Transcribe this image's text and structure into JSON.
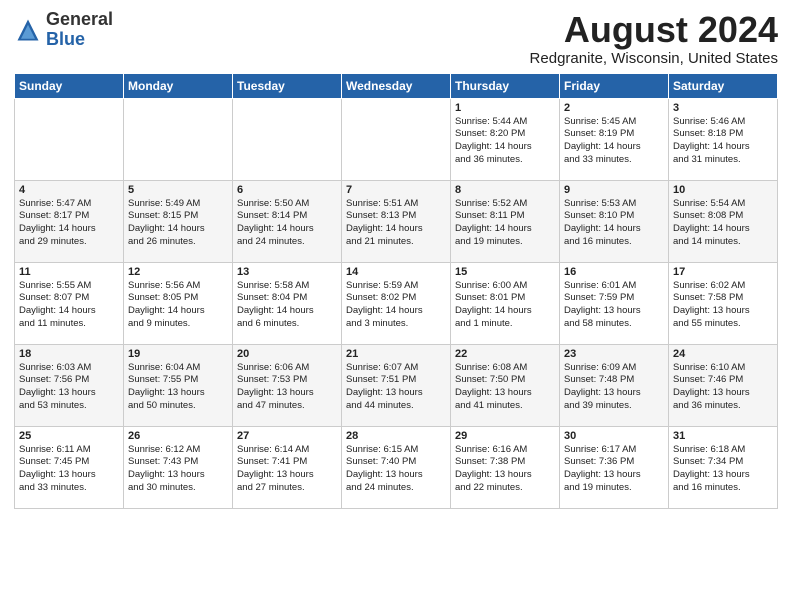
{
  "logo": {
    "general": "General",
    "blue": "Blue"
  },
  "title": "August 2024",
  "location": "Redgranite, Wisconsin, United States",
  "weekdays": [
    "Sunday",
    "Monday",
    "Tuesday",
    "Wednesday",
    "Thursday",
    "Friday",
    "Saturday"
  ],
  "weeks": [
    [
      {
        "day": "",
        "text": ""
      },
      {
        "day": "",
        "text": ""
      },
      {
        "day": "",
        "text": ""
      },
      {
        "day": "",
        "text": ""
      },
      {
        "day": "1",
        "text": "Sunrise: 5:44 AM\nSunset: 8:20 PM\nDaylight: 14 hours\nand 36 minutes."
      },
      {
        "day": "2",
        "text": "Sunrise: 5:45 AM\nSunset: 8:19 PM\nDaylight: 14 hours\nand 33 minutes."
      },
      {
        "day": "3",
        "text": "Sunrise: 5:46 AM\nSunset: 8:18 PM\nDaylight: 14 hours\nand 31 minutes."
      }
    ],
    [
      {
        "day": "4",
        "text": "Sunrise: 5:47 AM\nSunset: 8:17 PM\nDaylight: 14 hours\nand 29 minutes."
      },
      {
        "day": "5",
        "text": "Sunrise: 5:49 AM\nSunset: 8:15 PM\nDaylight: 14 hours\nand 26 minutes."
      },
      {
        "day": "6",
        "text": "Sunrise: 5:50 AM\nSunset: 8:14 PM\nDaylight: 14 hours\nand 24 minutes."
      },
      {
        "day": "7",
        "text": "Sunrise: 5:51 AM\nSunset: 8:13 PM\nDaylight: 14 hours\nand 21 minutes."
      },
      {
        "day": "8",
        "text": "Sunrise: 5:52 AM\nSunset: 8:11 PM\nDaylight: 14 hours\nand 19 minutes."
      },
      {
        "day": "9",
        "text": "Sunrise: 5:53 AM\nSunset: 8:10 PM\nDaylight: 14 hours\nand 16 minutes."
      },
      {
        "day": "10",
        "text": "Sunrise: 5:54 AM\nSunset: 8:08 PM\nDaylight: 14 hours\nand 14 minutes."
      }
    ],
    [
      {
        "day": "11",
        "text": "Sunrise: 5:55 AM\nSunset: 8:07 PM\nDaylight: 14 hours\nand 11 minutes."
      },
      {
        "day": "12",
        "text": "Sunrise: 5:56 AM\nSunset: 8:05 PM\nDaylight: 14 hours\nand 9 minutes."
      },
      {
        "day": "13",
        "text": "Sunrise: 5:58 AM\nSunset: 8:04 PM\nDaylight: 14 hours\nand 6 minutes."
      },
      {
        "day": "14",
        "text": "Sunrise: 5:59 AM\nSunset: 8:02 PM\nDaylight: 14 hours\nand 3 minutes."
      },
      {
        "day": "15",
        "text": "Sunrise: 6:00 AM\nSunset: 8:01 PM\nDaylight: 14 hours\nand 1 minute."
      },
      {
        "day": "16",
        "text": "Sunrise: 6:01 AM\nSunset: 7:59 PM\nDaylight: 13 hours\nand 58 minutes."
      },
      {
        "day": "17",
        "text": "Sunrise: 6:02 AM\nSunset: 7:58 PM\nDaylight: 13 hours\nand 55 minutes."
      }
    ],
    [
      {
        "day": "18",
        "text": "Sunrise: 6:03 AM\nSunset: 7:56 PM\nDaylight: 13 hours\nand 53 minutes."
      },
      {
        "day": "19",
        "text": "Sunrise: 6:04 AM\nSunset: 7:55 PM\nDaylight: 13 hours\nand 50 minutes."
      },
      {
        "day": "20",
        "text": "Sunrise: 6:06 AM\nSunset: 7:53 PM\nDaylight: 13 hours\nand 47 minutes."
      },
      {
        "day": "21",
        "text": "Sunrise: 6:07 AM\nSunset: 7:51 PM\nDaylight: 13 hours\nand 44 minutes."
      },
      {
        "day": "22",
        "text": "Sunrise: 6:08 AM\nSunset: 7:50 PM\nDaylight: 13 hours\nand 41 minutes."
      },
      {
        "day": "23",
        "text": "Sunrise: 6:09 AM\nSunset: 7:48 PM\nDaylight: 13 hours\nand 39 minutes."
      },
      {
        "day": "24",
        "text": "Sunrise: 6:10 AM\nSunset: 7:46 PM\nDaylight: 13 hours\nand 36 minutes."
      }
    ],
    [
      {
        "day": "25",
        "text": "Sunrise: 6:11 AM\nSunset: 7:45 PM\nDaylight: 13 hours\nand 33 minutes."
      },
      {
        "day": "26",
        "text": "Sunrise: 6:12 AM\nSunset: 7:43 PM\nDaylight: 13 hours\nand 30 minutes."
      },
      {
        "day": "27",
        "text": "Sunrise: 6:14 AM\nSunset: 7:41 PM\nDaylight: 13 hours\nand 27 minutes."
      },
      {
        "day": "28",
        "text": "Sunrise: 6:15 AM\nSunset: 7:40 PM\nDaylight: 13 hours\nand 24 minutes."
      },
      {
        "day": "29",
        "text": "Sunrise: 6:16 AM\nSunset: 7:38 PM\nDaylight: 13 hours\nand 22 minutes."
      },
      {
        "day": "30",
        "text": "Sunrise: 6:17 AM\nSunset: 7:36 PM\nDaylight: 13 hours\nand 19 minutes."
      },
      {
        "day": "31",
        "text": "Sunrise: 6:18 AM\nSunset: 7:34 PM\nDaylight: 13 hours\nand 16 minutes."
      }
    ]
  ]
}
